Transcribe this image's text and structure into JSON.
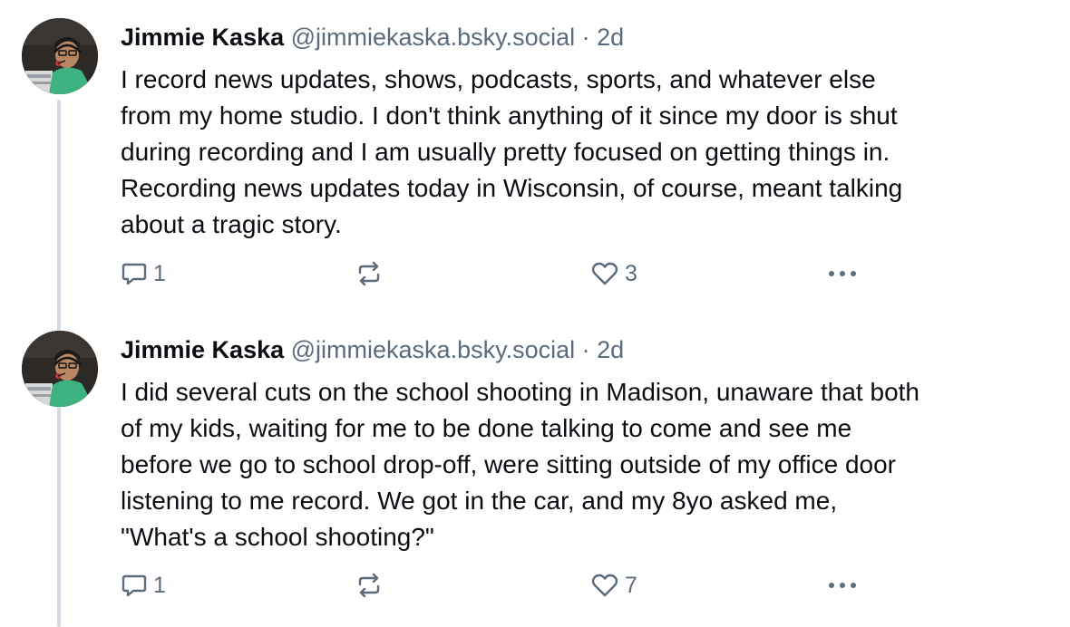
{
  "colors": {
    "text": "#0b0f14",
    "muted": "#5b6b7c",
    "thread_line": "#d4dbe2"
  },
  "posts": [
    {
      "author_name": "Jimmie Kaska",
      "handle": "@jimmiekaska.bsky.social",
      "separator": "·",
      "time": "2d",
      "text": "I record news updates, shows, podcasts, sports, and whatever else\nfrom my home studio. I don't think anything of it since my door is shut\nduring recording and I am usually pretty focused on getting things in.\nRecording news updates today in Wisconsin, of course, meant talking\nabout a tragic story.",
      "reply_count": "1",
      "like_count": "3"
    },
    {
      "author_name": "Jimmie Kaska",
      "handle": "@jimmiekaska.bsky.social",
      "separator": "·",
      "time": "2d",
      "text": "I did several cuts on the school shooting in Madison, unaware that both\nof my kids, waiting for me to be done talking to come and see me\nbefore we go to school drop-off, were sitting outside of my office door\nlistening to me record. We got in the car, and my 8yo asked me,\n\"What's a school shooting?\"",
      "reply_count": "1",
      "like_count": "7"
    }
  ],
  "icons": {
    "reply": "reply-icon",
    "repost": "repost-icon",
    "like": "heart-icon",
    "more": "more-dots-icon"
  }
}
